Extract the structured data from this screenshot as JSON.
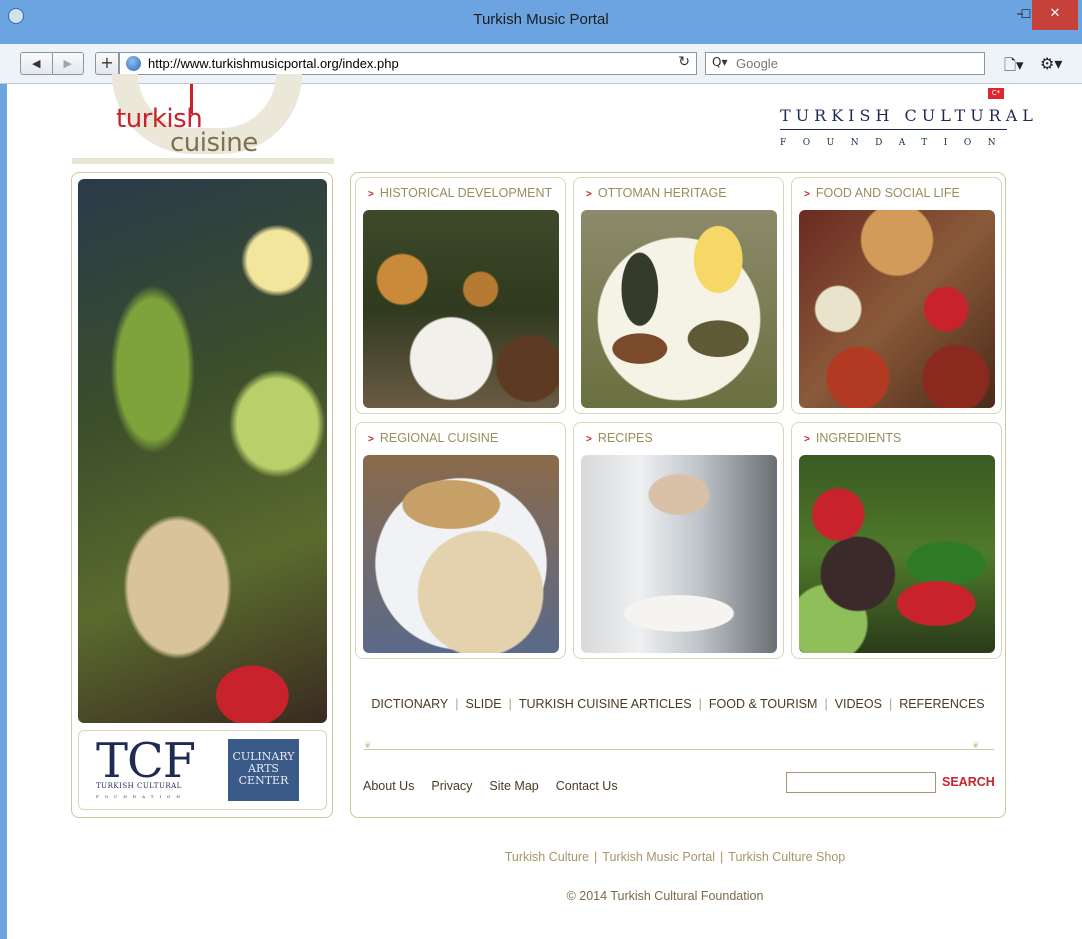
{
  "window": {
    "title": "Turkish Music Portal",
    "min": "–",
    "max": "☐",
    "close": "✕"
  },
  "toolbar": {
    "back": "◀",
    "forward": "▶",
    "new_tab": "+",
    "url": "http://www.turkishmusicportal.org/index.php",
    "reload": "↻",
    "search_icon": "Q▾",
    "search_placeholder": "Google",
    "page_menu": "🗋▾",
    "tools_menu": "⚙▾"
  },
  "logo": {
    "word1": "turkish",
    "word2": "cuisine"
  },
  "tcf_header": {
    "name": "TURKISH CULTURAL",
    "sub": "FOUNDATION",
    "flag": "C*"
  },
  "cards": [
    {
      "title": "HISTORICAL DEVELOPMENT"
    },
    {
      "title": "OTTOMAN HERITAGE"
    },
    {
      "title": "FOOD AND SOCIAL LIFE"
    },
    {
      "title": "REGIONAL CUISINE"
    },
    {
      "title": "RECIPES"
    },
    {
      "title": "INGREDIENTS"
    }
  ],
  "nav_links": [
    "DICTIONARY",
    "SLIDE",
    "TURKISH CUISINE ARTICLES",
    "FOOD & TOURISM",
    "VIDEOS",
    "REFERENCES"
  ],
  "nav_sep": "|",
  "bottom_links": [
    "About Us",
    "Privacy",
    "Site Map",
    "Contact Us"
  ],
  "search_button": "SEARCH",
  "tcf_logo": {
    "big": "TCF",
    "small": "TURKISH CULTURAL",
    "found": "FOUNDATION"
  },
  "cac_logo": {
    "line1": "CULINARY",
    "line2": "ARTS",
    "line3": "CENTER"
  },
  "footer": {
    "links": [
      "Turkish Culture",
      "Turkish Music Portal",
      "Turkish Culture Shop"
    ],
    "sep": "|",
    "copyright": "© 2014 Turkish Cultural Foundation"
  }
}
